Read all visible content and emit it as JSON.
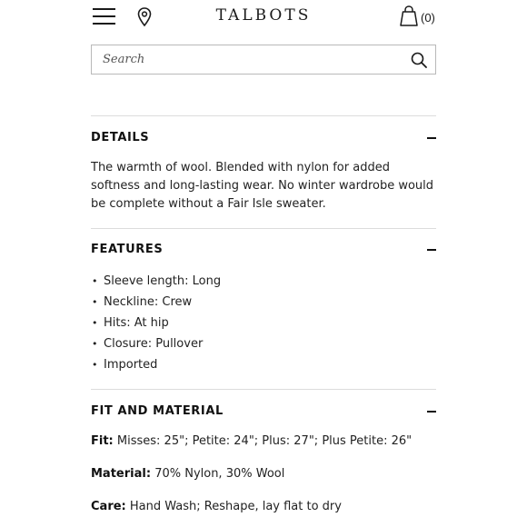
{
  "header": {
    "logo": "TALBOTS",
    "bag_count": "(0)",
    "menu_icon": "hamburger-menu-icon",
    "location_icon": "map-pin-icon",
    "bag_icon": "shopping-bag-icon"
  },
  "search": {
    "placeholder": "Search",
    "icon": "search-icon"
  },
  "details": {
    "title": "DETAILS",
    "text": "The warmth of wool. Blended with nylon for added softness and long-lasting wear. No winter wardrobe would be complete without a Fair Isle sweater."
  },
  "features": {
    "title": "FEATURES",
    "items": [
      "Sleeve length: Long",
      "Neckline: Crew",
      "Hits: At hip",
      "Closure: Pullover",
      "Imported"
    ]
  },
  "fit_material": {
    "title": "FIT AND MATERIAL",
    "fit_label": "Fit:",
    "fit_value": "Misses: 25\"; Petite: 24\"; Plus: 27\"; Plus Petite: 26\"",
    "material_label": "Material:",
    "material_value": "70% Nylon, 30% Wool",
    "care_label": "Care:",
    "care_value": "Hand Wash; Reshape, lay flat to dry"
  },
  "colors": {
    "text": "#1a1a1a",
    "divider": "#dcdcdc",
    "border": "#b9b9b9"
  }
}
